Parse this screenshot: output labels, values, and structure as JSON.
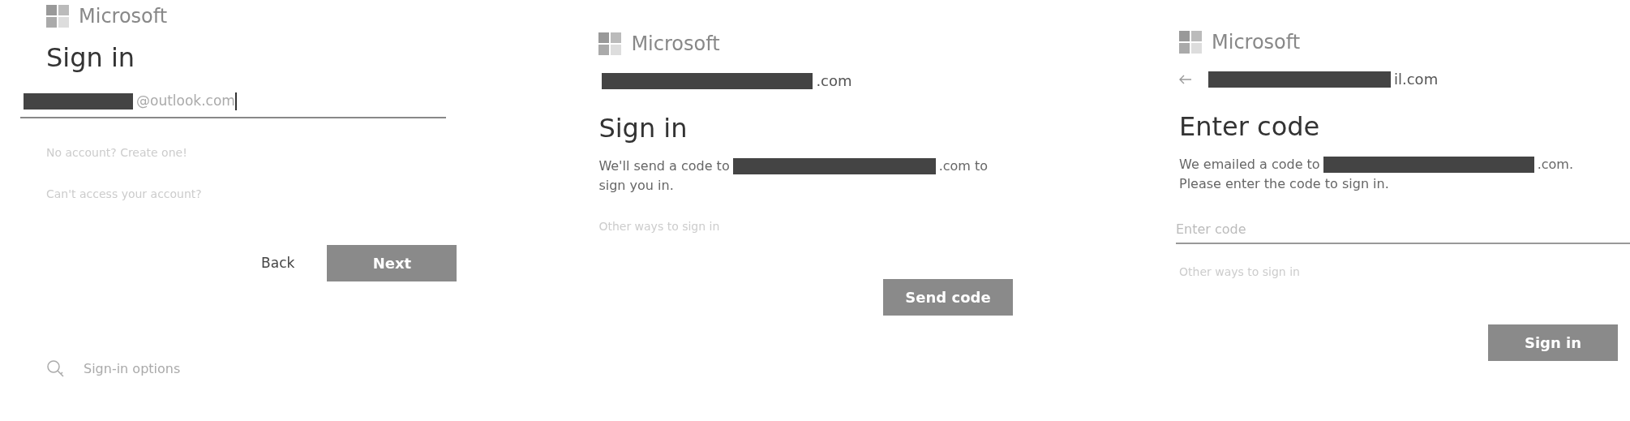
{
  "panels": [
    {
      "logo": "Microsoft",
      "title": "Sign in",
      "email_field": {
        "value": "@outlook.com",
        "redacted": true
      },
      "links": [
        "No account? Create one!",
        "Can't access your account?"
      ],
      "buttons": [
        {
          "label": "Back",
          "kind": "secondary"
        },
        {
          "label": "Next",
          "kind": "primary"
        }
      ],
      "footer_option": "Sign-in options"
    },
    {
      "logo": "Microsoft",
      "identity": {
        "text": ".com",
        "redacted": true,
        "back": false
      },
      "title": "Sign in",
      "message": {
        "before": "We'll send a code to ",
        "redacted": true,
        "after": ".com to",
        "line2": "sign you in."
      },
      "links": [
        "Other ways to sign in"
      ],
      "buttons": [
        {
          "label": "Send code",
          "kind": "primary"
        }
      ]
    },
    {
      "logo": "Microsoft",
      "identity": {
        "text": "il.com",
        "redacted": true,
        "back": true
      },
      "title": "Enter code",
      "message": {
        "before": "We emailed a code to ",
        "redacted": true,
        "after": ".com.",
        "line2": "Please enter the code to sign in."
      },
      "code_field": {
        "placeholder": "Enter code"
      },
      "links": [
        "Other ways to sign in"
      ],
      "buttons": [
        {
          "label": "Sign in",
          "kind": "primary"
        }
      ]
    }
  ]
}
